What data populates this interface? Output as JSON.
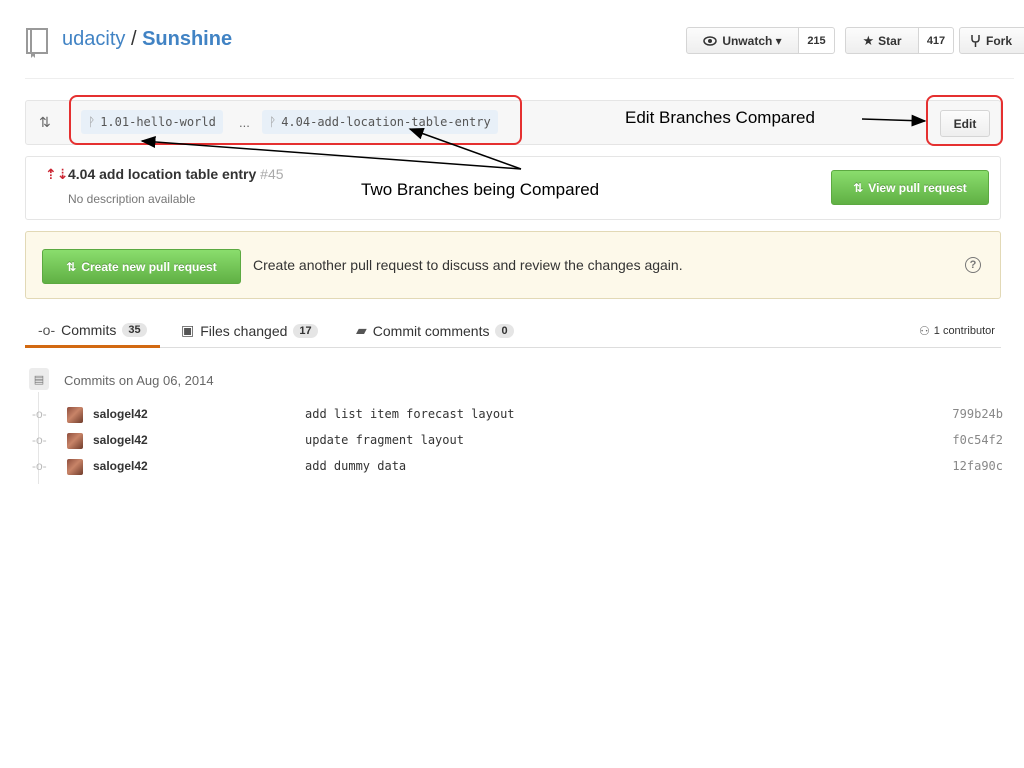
{
  "header": {
    "owner": "udacity",
    "separator": "/",
    "repo": "Sunshine",
    "unwatch_label": "Unwatch ▾",
    "unwatch_count": "215",
    "star_label": "Star",
    "star_count": "417",
    "fork_label": "Fork"
  },
  "range": {
    "base_branch": "1.01-hello-world",
    "ellipsis": "...",
    "head_branch": "4.04-add-location-table-entry",
    "edit_label": "Edit"
  },
  "pull_request": {
    "title": "4.04 add location table entry",
    "number": "#45",
    "description": "No description available",
    "view_button": "View pull request"
  },
  "flash": {
    "create_button": "Create new pull request",
    "message": "Create another pull request to discuss and review the changes again.",
    "help_glyph": "?"
  },
  "tabs": [
    {
      "label": "Commits",
      "count": "35",
      "icon": "commit-icon"
    },
    {
      "label": "Files changed",
      "count": "17",
      "icon": "diff-icon"
    },
    {
      "label": "Commit comments",
      "count": "0",
      "icon": "comment-icon"
    }
  ],
  "contributors": "1 contributor",
  "commits": {
    "date_heading": "Commits on Aug 06, 2014",
    "items": [
      {
        "author": "salogel42",
        "message": "add list item forecast layout",
        "sha": "799b24b"
      },
      {
        "author": "salogel42",
        "message": "update fragment layout",
        "sha": "f0c54f2"
      },
      {
        "author": "salogel42",
        "message": "add dummy data",
        "sha": "12fa90c"
      }
    ]
  },
  "annotations": {
    "edit_branches": "Edit Branches Compared",
    "two_branches": "Two Branches being Compared",
    "color": "#e53030"
  },
  "colors": {
    "link": "#4183c4",
    "green": "#60b044",
    "flash_bg": "#fdf9ea",
    "active_tab": "#d26911"
  }
}
